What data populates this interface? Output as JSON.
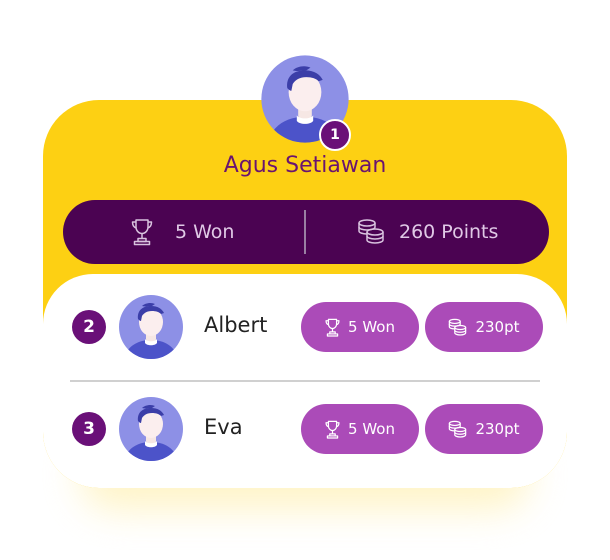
{
  "winner": {
    "rank": "1",
    "name": "Agus Setiawan",
    "won_label": "5 Won",
    "points_label": "260 Points",
    "avatar_icon": "user-avatar-icon"
  },
  "players": [
    {
      "rank": "2",
      "name": "Albert",
      "won_label": "5 Won",
      "points_label": "230pt"
    },
    {
      "rank": "3",
      "name": "Eva",
      "won_label": "5 Won",
      "points_label": "230pt"
    }
  ],
  "icons": {
    "trophy": "trophy-icon",
    "coins": "coins-stack-icon"
  },
  "colors": {
    "card_yellow": "#fdd013",
    "stats_bar": "#4b0352",
    "pill": "#ab4bb8",
    "rank_badge": "#6a1078",
    "name_purple": "#6a1470",
    "avatar_bg": "#8d90e6"
  }
}
